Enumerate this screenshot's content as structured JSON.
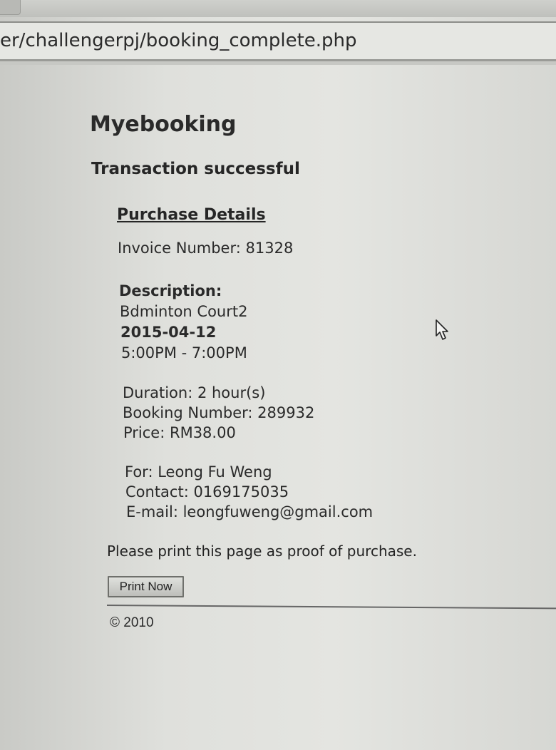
{
  "browser": {
    "url": "er/challengerpj/booking_complete.php"
  },
  "page": {
    "site_title": "Myebooking",
    "status": "Transaction successful",
    "section_title": "Purchase Details",
    "invoice": "Invoice Number: 81328",
    "description_label": "Description:",
    "court": "Bdminton Court2",
    "date": "2015-04-12",
    "time": "5:00PM - 7:00PM",
    "duration": "Duration: 2 hour(s)",
    "booking_number": "Booking Number: 289932",
    "price": "Price: RM38.00",
    "for": "For: Leong Fu Weng",
    "contact": "Contact: 0169175035",
    "email": "E-mail: leongfuweng@gmail.com",
    "print_note": "Please print this page as proof of purchase.",
    "print_button": "Print Now",
    "footer": "© 2010"
  },
  "icons": {
    "cursor": "mouse-pointer-icon"
  }
}
